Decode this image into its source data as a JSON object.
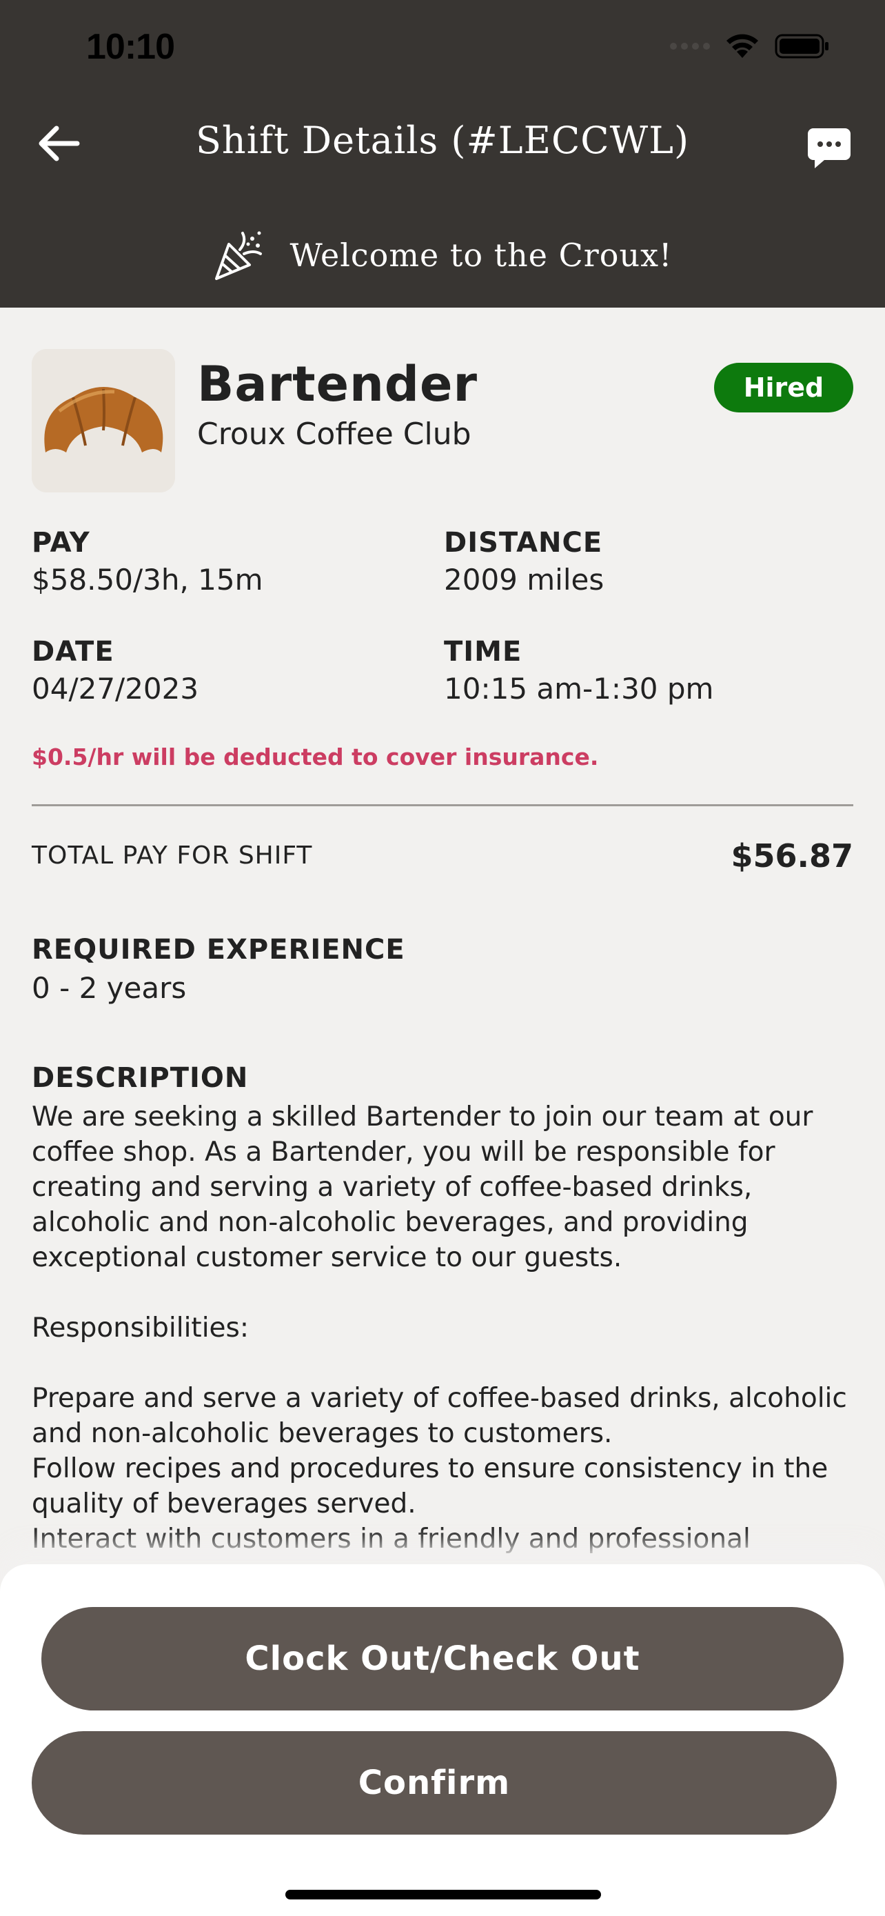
{
  "status_bar": {
    "time": "10:10"
  },
  "header": {
    "title": "Shift Details (#LECCWL)",
    "welcome": "Welcome to the Croux!",
    "background_color": "#383532",
    "icons": {
      "back": "arrow-left-icon",
      "chat": "chat-bubble-icon",
      "celebration": "party-popper-icon"
    }
  },
  "job": {
    "title": "Bartender",
    "company": "Croux Coffee Club",
    "status": "Hired",
    "status_color": "#0d7a0d",
    "image": "croissant-image"
  },
  "details": {
    "pay_label": "PAY",
    "pay_value": "$58.50/3h, 15m",
    "distance_label": "DISTANCE",
    "distance_value": "2009 miles",
    "date_label": "DATE",
    "date_value": "04/27/2023",
    "time_label": "TIME",
    "time_value": "10:15 am-1:30 pm"
  },
  "insurance_note": "$0.5/hr will be deducted to cover insurance.",
  "total": {
    "label": "TOTAL PAY FOR SHIFT",
    "value": "$56.87"
  },
  "experience": {
    "label": "REQUIRED EXPERIENCE",
    "value": "0 - 2 years"
  },
  "description": {
    "label": "DESCRIPTION",
    "text": "We are seeking a skilled Bartender to join our team at our coffee shop. As a Bartender, you will be responsible for creating and serving a variety of coffee-based drinks, alcoholic and non-alcoholic beverages, and providing exceptional customer service to our guests.\n\nResponsibilities:\n\nPrepare and serve a variety of coffee-based drinks, alcoholic and non-alcoholic beverages to customers.\nFollow recipes and procedures to ensure consistency in the quality of beverages served.\nInteract with customers in a friendly and professional"
  },
  "actions": {
    "clock_out": "Clock Out/Check Out",
    "confirm": "Confirm",
    "button_color": "#5f5752"
  }
}
